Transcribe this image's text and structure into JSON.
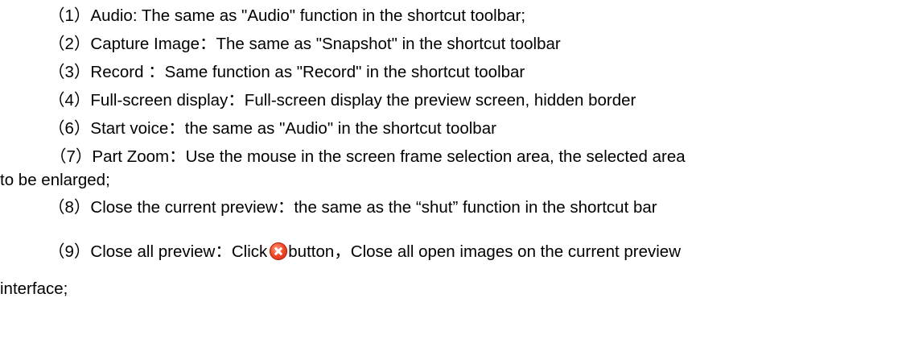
{
  "items": [
    {
      "num": "（1）",
      "text": "Audio: The same as \"Audio\" function in the shortcut toolbar;"
    },
    {
      "num": "（2）",
      "text": "Capture Image：The same as \"Snapshot\" in the shortcut toolbar"
    },
    {
      "num": "（3）",
      "text": "Record ：Same function as \"Record\" in the shortcut toolbar"
    },
    {
      "num": "（4）",
      "text": "Full-screen display：Full-screen display the preview screen, hidden border"
    },
    {
      "num": "（6）",
      "text": "Start voice：the same as \"Audio\" in the shortcut toolbar"
    },
    {
      "num": "（7）",
      "text": "Part Zoom：Use the mouse in the screen frame selection area, the selected area",
      "continuation": "to be enlarged;"
    },
    {
      "num": "（8）",
      "text": "Close the current preview：the same as the “shut” function in the shortcut bar"
    },
    {
      "num": "（9）",
      "text_before_icon": "Close all preview：Click",
      "icon": "close-icon",
      "text_after_icon": "button，Close all open images on the current preview",
      "continuation": "interface;"
    }
  ]
}
